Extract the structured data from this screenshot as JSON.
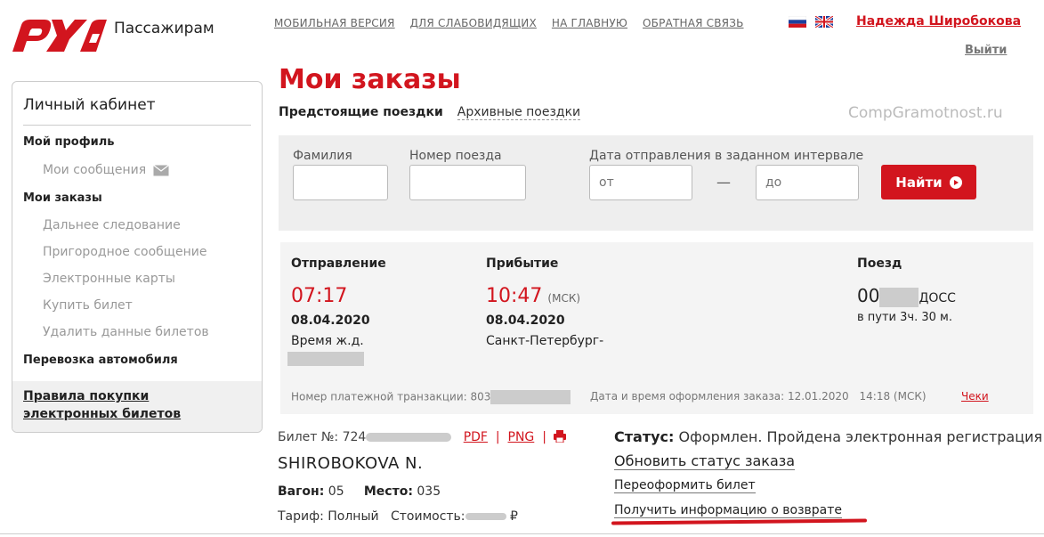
{
  "header": {
    "brand": "Пассажирам",
    "nav": [
      "МОБИЛЬНАЯ ВЕРСИЯ",
      "ДЛЯ СЛАБОВИДЯЩИХ",
      "НА ГЛАВНУЮ",
      "ОБРАТНАЯ СВЯЗЬ"
    ],
    "user": "Надежда Широбокова",
    "logout": "Выйти"
  },
  "sidebar": {
    "title": "Личный кабинет",
    "profile": "Мой профиль",
    "messages": "Мои сообщения",
    "orders": "Мои заказы",
    "long_distance": "Дальнее следование",
    "suburban": "Пригородное сообщение",
    "e_cards": "Электронные карты",
    "buy_ticket": "Купить билет",
    "delete_data": "Удалить данные билетов",
    "car_transport": "Перевозка автомобиля",
    "rules": "Правила покупки электронных билетов"
  },
  "main": {
    "title": "Мои заказы",
    "tab_upcoming": "Предстоящие поездки",
    "tab_archive": "Архивные поездки",
    "watermark": "CompGramotnost.ru"
  },
  "filter": {
    "surname_label": "Фамилия",
    "train_label": "Номер поезда",
    "date_label": "Дата отправления в заданном интервале",
    "date_from_placeholder": "от",
    "date_to_placeholder": "до",
    "dash": "—",
    "find_button": "Найти"
  },
  "trip": {
    "departure_label": "Отправление",
    "arrival_label": "Прибытие",
    "train_label": "Поезд",
    "departure_time": "07:17",
    "arrival_time": "10:47",
    "timezone": "(МСК)",
    "departure_date": "08.04.2020",
    "arrival_date": "08.04.2020",
    "departure_station": "Время ж.д.",
    "arrival_station": "Санкт-Петербург-",
    "train_number_prefix": "00",
    "train_suffix": "ДОСС",
    "duration": "в пути 3ч. 30 м.",
    "transaction_label": "Номер платежной транзакции:",
    "transaction_prefix": "803",
    "order_datetime_label": "Дата и время оформления заказа:",
    "order_date": "12.01.2020",
    "order_time": "14:18",
    "order_tz": "(МСК)",
    "checks": "Чеки"
  },
  "ticket": {
    "number_label": "Билет №:",
    "number_prefix": "724",
    "pdf": "PDF",
    "separator": "|",
    "png": "PNG",
    "passenger": "SHIROBOKOVA N.",
    "car_label": "Вагон:",
    "car": "05",
    "seat_label": "Место:",
    "seat": "035",
    "fare_label": "Тариф:",
    "fare": "Полный",
    "cost_label": "Стоимость:",
    "currency": "₽"
  },
  "status": {
    "label": "Статус:",
    "value": "Оформлен. Пройдена электронная регистрация",
    "refresh": "Обновить статус заказа",
    "reissue": "Переоформить билет",
    "refund_info": "Получить информацию о возврате"
  },
  "colors": {
    "brand_red": "#d2151e",
    "muted": "#999999"
  }
}
